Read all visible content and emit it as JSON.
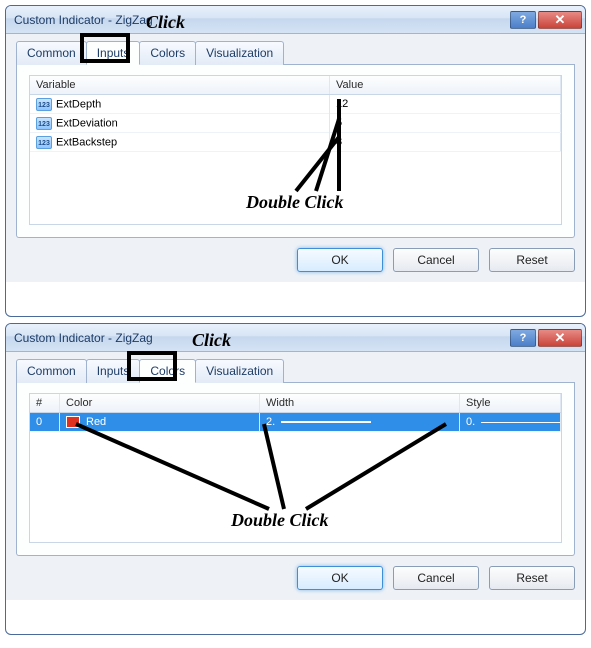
{
  "dialog1": {
    "title": "Custom Indicator - ZigZag",
    "tabs": [
      "Common",
      "Inputs",
      "Colors",
      "Visualization"
    ],
    "activeTab": "Inputs",
    "columns": {
      "variable": "Variable",
      "value": "Value"
    },
    "rows": [
      {
        "name": "ExtDepth",
        "value": "12"
      },
      {
        "name": "ExtDeviation",
        "value": "5"
      },
      {
        "name": "ExtBackstep",
        "value": "3"
      }
    ],
    "buttons": {
      "ok": "OK",
      "cancel": "Cancel",
      "reset": "Reset"
    }
  },
  "dialog2": {
    "title": "Custom Indicator - ZigZag",
    "tabs": [
      "Common",
      "Inputs",
      "Colors",
      "Visualization"
    ],
    "activeTab": "Colors",
    "columns": {
      "idx": "#",
      "color": "Color",
      "width": "Width",
      "style": "Style"
    },
    "rows": [
      {
        "idx": "0",
        "colorName": "Red",
        "colorHex": "#e03020",
        "width": "2.",
        "style": "0."
      }
    ],
    "buttons": {
      "ok": "OK",
      "cancel": "Cancel",
      "reset": "Reset"
    }
  },
  "annotations": {
    "clickLabel": "Click",
    "doubleClickLabel": "Double Click",
    "helpGlyph": "?",
    "closeGlyph": "✕",
    "varIconGlyph": "123"
  }
}
